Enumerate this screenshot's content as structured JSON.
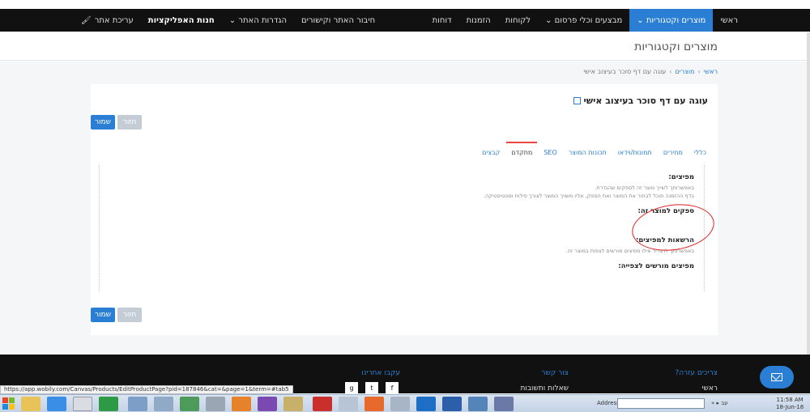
{
  "topnav": {
    "items": [
      "ראשי",
      "מוצרים וקטגוריות",
      "מבצעים וכלי פרסום",
      "לקוחות",
      "הזמנות",
      "דוחות"
    ],
    "active_index": 1,
    "edit_site": "עריכת אתר",
    "app_store": "חנות האפליקציות",
    "site_settings": "הגדרות האתר",
    "connect_site": "חיבור האתר וקישורים"
  },
  "page": {
    "title": "מוצרים וקטגוריות"
  },
  "breadcrumb": {
    "home": "ראשי",
    "products": "מוצרים",
    "current": "עוגה עם דף סוכר בעיצוב אישי"
  },
  "product": {
    "title": "עוגה עם דף סוכר בעיצוב אישי"
  },
  "buttons": {
    "save": "שמור",
    "back": "חזור"
  },
  "tabs": [
    "כללי",
    "מחירים",
    "תמונות/וידאו",
    "תכונות המוצר",
    "SEO",
    "מתקדם",
    "קבצים"
  ],
  "active_tab_index": 5,
  "advanced": {
    "distributors_title": "מפיצים:",
    "distributors_text1": "באפשרותך לשייך מוצר זה לספקים שהגדרת.",
    "distributors_text2": "בדף ההזמנה תוכל לבחור את המוצר ואת הספק, אליו משויך המוצר לצורך פילוח וסטטיסטיקה.",
    "suppliers_title": "ספקים למוצר זה:",
    "permissions_title": "הרשאות למפיצים:",
    "permissions_text": "באפשרותך להגדיר אילו מפיצים מורשים לצפות במוצר זה.",
    "allowed_title": "מפיצים מורשים לצפייה:"
  },
  "footer": {
    "help_title": "צריכים עזרה?",
    "help_link": "ראשי",
    "contact_title": "צור קשר",
    "contact_link": "שאלות ותשובות",
    "follow_title": "עקבו אחרינו",
    "social": [
      "f",
      "t",
      "g"
    ]
  },
  "status_url": "https://app.wobily.com/Canvas/Products/EditProductPage?pid=187846&cat=&page=1&term=#tab5",
  "taskbar": {
    "address_label": "Address",
    "tray_lang": "עב",
    "time": "11:58 AM",
    "date": "18-Jun-18"
  },
  "colors": {
    "accent": "#2a7fd4",
    "topnav_bg": "#111111",
    "annotation": "#dd2222"
  }
}
